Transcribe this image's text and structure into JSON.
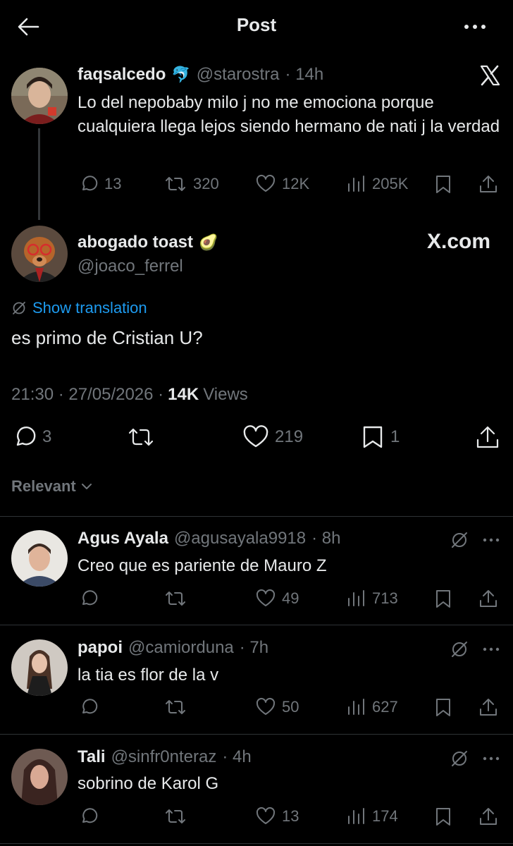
{
  "header": {
    "title": "Post"
  },
  "quoted": {
    "name": "faqsalcedo",
    "name_emoji": "🐬",
    "handle": "@starostra",
    "time": "· 14h",
    "text": "Lo del nepobaby milo j no me emociona porque cualquiera llega lejos siendo hermano de nati j la verdad",
    "replies": "13",
    "reposts": "320",
    "likes": "12K",
    "views": "205K"
  },
  "main": {
    "name": "abogado toast",
    "name_emoji": "🥑",
    "handle": "@joaco_ferrel",
    "watermark": "X.com",
    "translate": "Show translation",
    "text": "es primo de Cristian U?",
    "time": "21:30 · 27/05/2026 ·",
    "views_count": "14K",
    "views_label": "Views",
    "replies": "3",
    "likes": "219",
    "bookmarks": "1"
  },
  "sort": {
    "label": "Relevant"
  },
  "replies": [
    {
      "name": "Agus Ayala",
      "handle": "@agusayala9918",
      "time": "· 8h",
      "text": "Creo que es pariente de Mauro Z",
      "likes": "49",
      "views": "713"
    },
    {
      "name": "papoi",
      "handle": "@camiorduna",
      "time": "· 7h",
      "text": "la tia es flor de la v",
      "likes": "50",
      "views": "627"
    },
    {
      "name": "Tali",
      "handle": "@sinfr0nteraz",
      "time": "· 4h",
      "text": "sobrino de Karol G",
      "likes": "13",
      "views": "174"
    }
  ],
  "colors": {
    "background": "#000000",
    "text": "#e7e9ea",
    "muted": "#71767b",
    "accent": "#1d9bf0",
    "divider": "#2f3336"
  }
}
